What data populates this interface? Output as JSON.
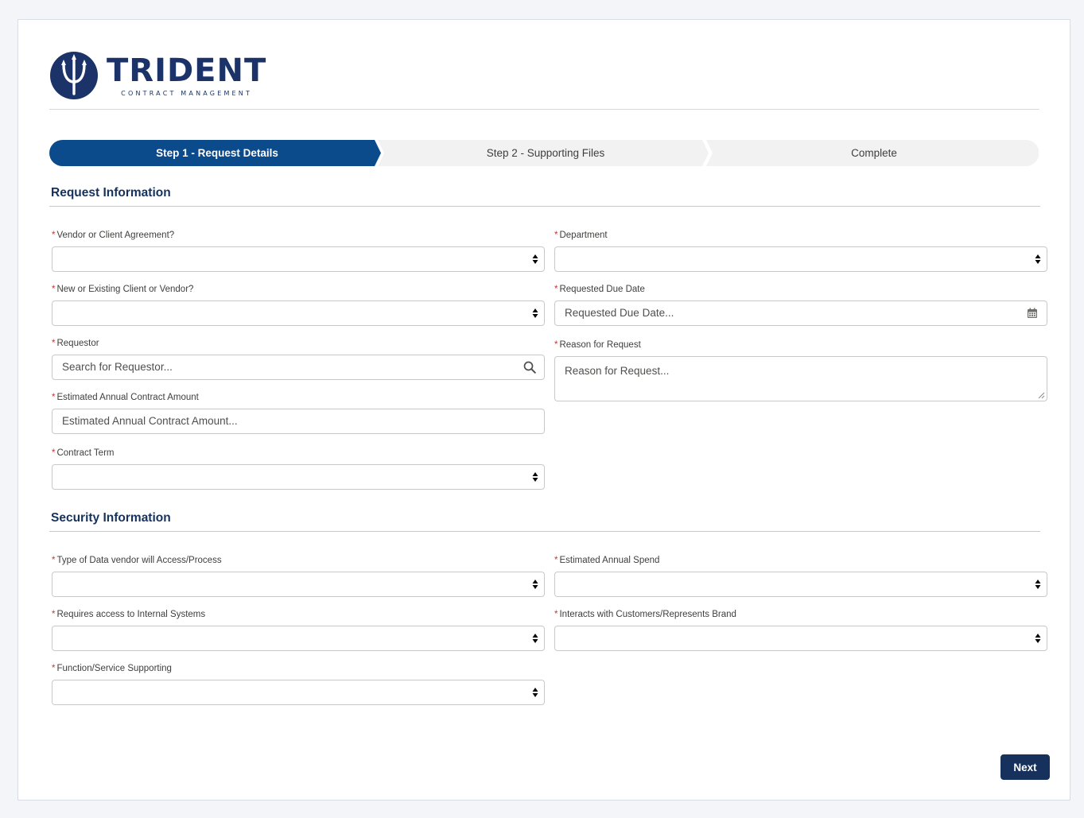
{
  "brand": {
    "name": "TRIDENT",
    "tagline": "CONTRACT MANAGEMENT",
    "color": "#1b3368"
  },
  "path": {
    "steps": [
      {
        "label": "Step 1 - Request Details",
        "state": "active"
      },
      {
        "label": "Step 2 - Supporting Files",
        "state": "incomplete"
      },
      {
        "label": "Complete",
        "state": "incomplete"
      }
    ],
    "active_color": "#0b4a8b",
    "inactive_color": "#f2f2f2"
  },
  "sections": {
    "request": {
      "title": "Request Information",
      "fields": {
        "vendor_client_agreement": {
          "label": "Vendor or Client Agreement?",
          "required": "*",
          "value": ""
        },
        "new_existing": {
          "label": "New or Existing Client or Vendor?",
          "required": "*",
          "value": ""
        },
        "requestor": {
          "label": "Requestor",
          "required": "*",
          "placeholder": "Search for Requestor..."
        },
        "annual_contract_amount": {
          "label": "Estimated Annual Contract Amount",
          "required": "*",
          "placeholder": "Estimated Annual Contract Amount..."
        },
        "contract_term": {
          "label": "Contract Term",
          "required": "*",
          "value": ""
        },
        "department": {
          "label": "Department",
          "required": "*",
          "value": ""
        },
        "requested_due_date": {
          "label": "Requested Due Date",
          "required": "*",
          "placeholder": "Requested Due Date..."
        },
        "reason": {
          "label": "Reason for Request",
          "required": "*",
          "placeholder": "Reason for Request..."
        }
      }
    },
    "security": {
      "title": "Security Information",
      "fields": {
        "data_type": {
          "label": "Type of Data vendor will Access/Process",
          "required": "*",
          "value": ""
        },
        "internal_systems": {
          "label": "Requires access to Internal Systems",
          "required": "*",
          "value": ""
        },
        "function_service": {
          "label": "Function/Service Supporting",
          "required": "*",
          "value": ""
        },
        "annual_spend": {
          "label": "Estimated Annual Spend",
          "required": "*",
          "value": ""
        },
        "interacts_customers": {
          "label": "Interacts with Customers/Represents Brand",
          "required": "*",
          "value": ""
        }
      }
    }
  },
  "actions": {
    "next_label": "Next"
  },
  "icons": {
    "select": "updown-arrows-icon",
    "search": "search-icon",
    "date": "calendar-icon",
    "logo": "trident-icon"
  }
}
